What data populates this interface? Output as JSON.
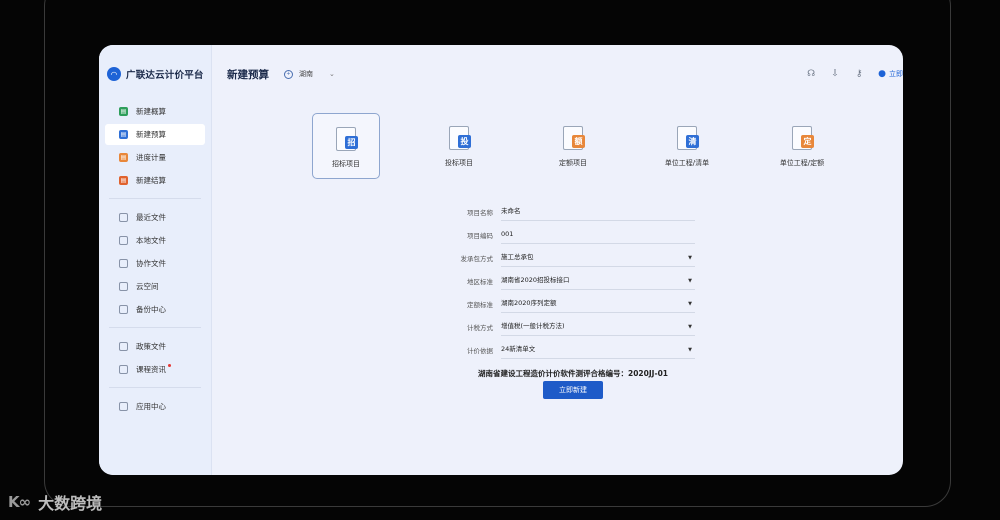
{
  "app": {
    "brand_name": "广联达云计价平台",
    "page_title": "新建预算",
    "region": "湖南",
    "user_label": "立即"
  },
  "sidebar": {
    "group1": [
      {
        "label": "新建概算",
        "icon": "estimate-icon",
        "color": "#2e9e5b"
      },
      {
        "label": "新建预算",
        "icon": "budget-icon",
        "color": "#2f6fd6",
        "active": true
      },
      {
        "label": "进度计量",
        "icon": "progress-icon",
        "color": "#e8873a"
      },
      {
        "label": "新建结算",
        "icon": "settlement-icon",
        "color": "#e0622e"
      }
    ],
    "group2": [
      {
        "label": "最近文件",
        "icon": "recent-icon"
      },
      {
        "label": "本地文件",
        "icon": "local-file-icon"
      },
      {
        "label": "协作文件",
        "icon": "collab-icon"
      },
      {
        "label": "云空间",
        "icon": "cloud-icon"
      },
      {
        "label": "备份中心",
        "icon": "backup-icon"
      }
    ],
    "group3": [
      {
        "label": "政策文件",
        "icon": "policy-icon"
      },
      {
        "label": "课程资讯",
        "icon": "course-icon",
        "dot": true
      }
    ],
    "group4": [
      {
        "label": "应用中心",
        "icon": "apps-icon"
      }
    ]
  },
  "project_types": [
    {
      "label": "招标项目",
      "glyph": "招",
      "color": "#2f6fd6",
      "selected": true
    },
    {
      "label": "投标项目",
      "glyph": "投",
      "color": "#2f6fd6"
    },
    {
      "label": "定额项目",
      "glyph": "额",
      "color": "#e8873a"
    },
    {
      "label": "单位工程/清单",
      "glyph": "清",
      "color": "#2f6fd6"
    },
    {
      "label": "单位工程/定额",
      "glyph": "定",
      "color": "#e8873a"
    }
  ],
  "form": {
    "project_name": {
      "label": "项目名称",
      "value": "未命名"
    },
    "project_code": {
      "label": "项目编码",
      "value": "001"
    },
    "contract_mode": {
      "label": "发承包方式",
      "value": "施工总承包"
    },
    "region_standard": {
      "label": "地区标准",
      "value": "湖南省2020招投标接口"
    },
    "quota_standard": {
      "label": "定额标准",
      "value": "湖南2020序列定额"
    },
    "tax_method": {
      "label": "计税方式",
      "value": "增值税(一般计税方法)"
    },
    "pricing_basis": {
      "label": "计价依据",
      "value": "24新清单文"
    }
  },
  "certificate": "湖南省建设工程造价计价软件测评合格编号：2020JJ-01",
  "create_button": "立即新建",
  "watermark": "大数跨境"
}
